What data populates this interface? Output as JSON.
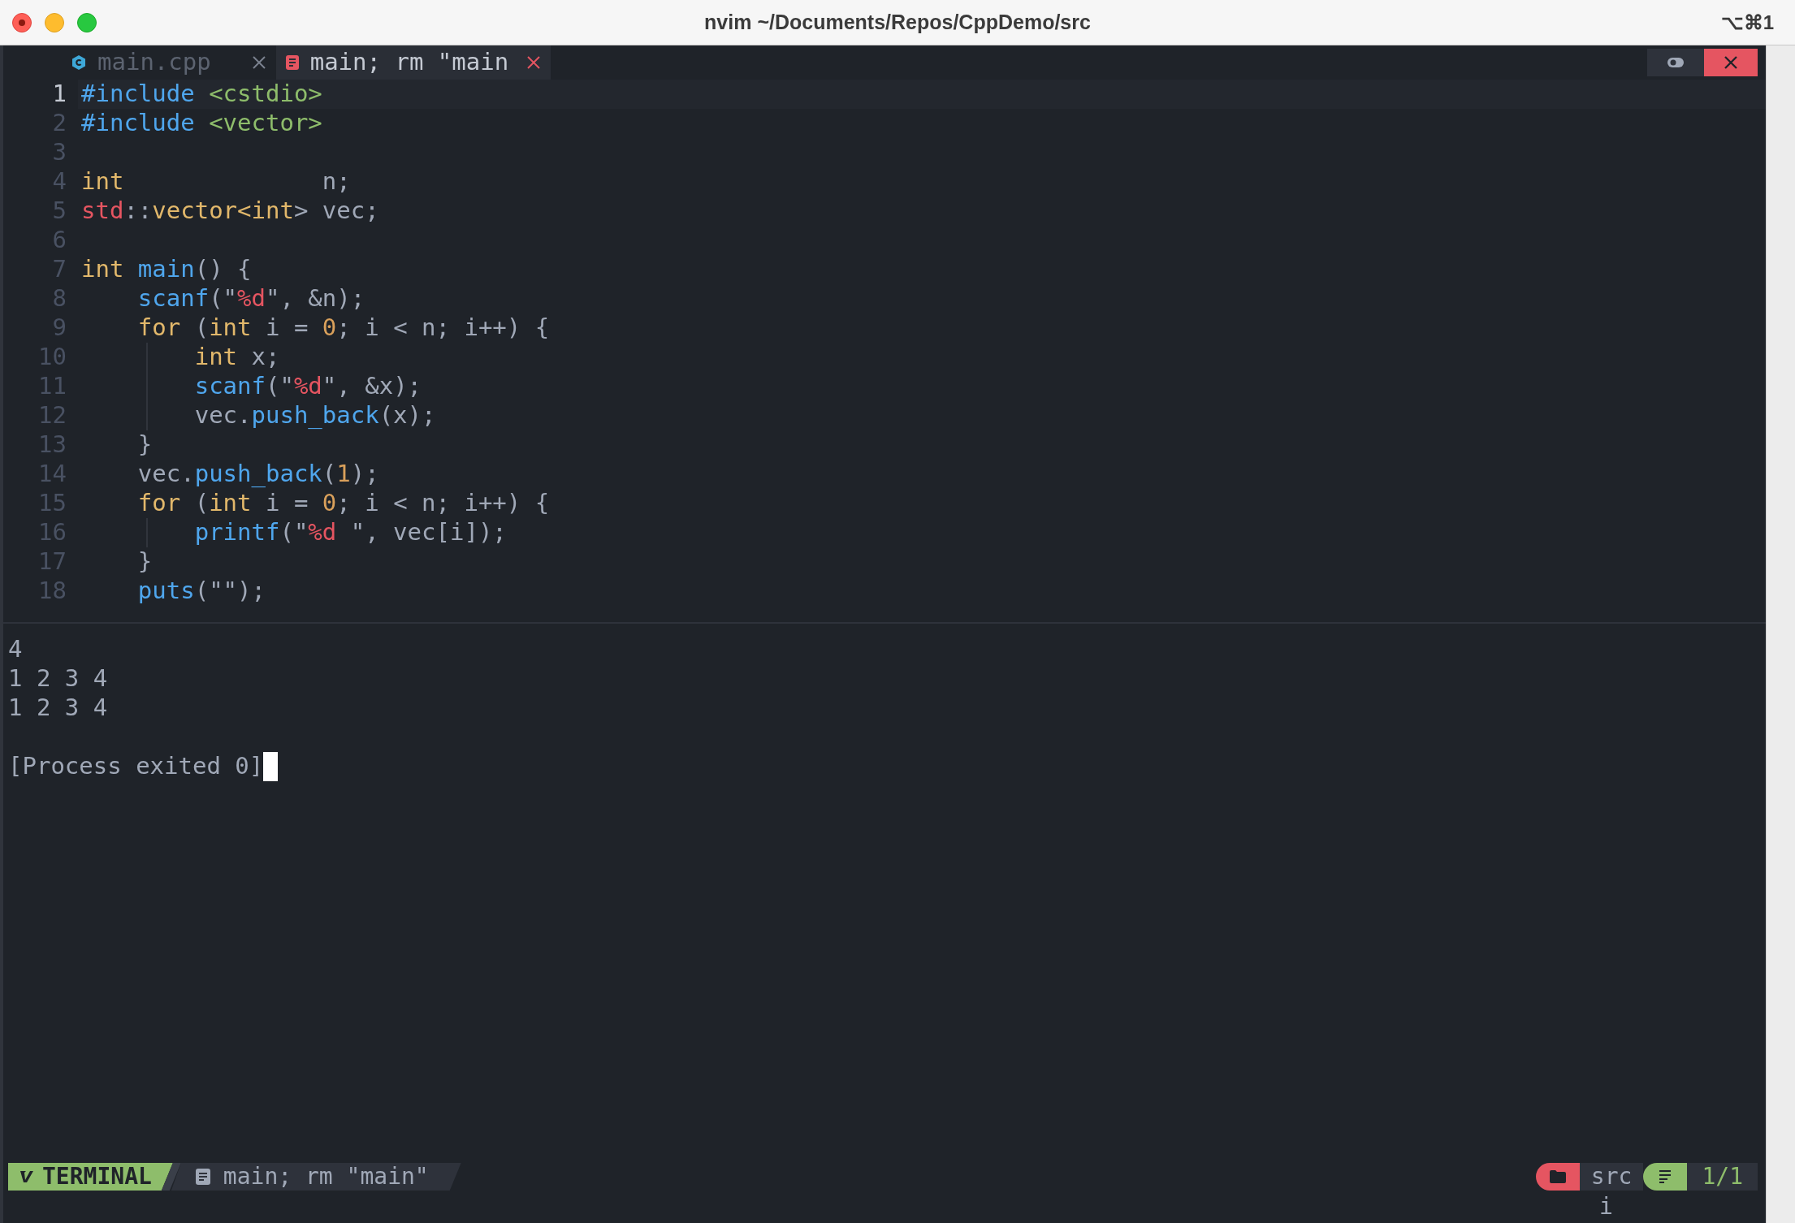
{
  "window": {
    "title": "nvim ~/Documents/Repos/CppDemo/src",
    "shortcut": "⌥⌘1"
  },
  "tabs": [
    {
      "label": "main.cpp",
      "selected": false,
      "kind": "source"
    },
    {
      "label": "main; rm \"main",
      "selected": true,
      "kind": "terminal"
    }
  ],
  "code_lines": [
    {
      "number": "1",
      "current": true,
      "guide": false,
      "tokens": [
        {
          "t": "#include ",
          "kind": "preproc"
        },
        {
          "t": "<cstdio>",
          "kind": "path"
        }
      ]
    },
    {
      "number": "2",
      "current": false,
      "guide": false,
      "tokens": [
        {
          "t": "#include ",
          "kind": "preproc"
        },
        {
          "t": "<vector>",
          "kind": "path"
        }
      ]
    },
    {
      "number": "3",
      "current": false,
      "guide": false
    },
    {
      "number": "4",
      "current": false,
      "guide": false,
      "tokens": [
        {
          "t": "int",
          "kind": "type"
        },
        {
          "t": "              n;",
          "kind": "plain"
        }
      ]
    },
    {
      "number": "5",
      "current": false,
      "guide": false,
      "tokens": [
        {
          "t": "std",
          "kind": "namespace"
        },
        {
          "t": "::",
          "kind": "plain"
        },
        {
          "t": "vector<int",
          "kind": "type"
        },
        {
          "t": "> vec;",
          "kind": "plain"
        }
      ]
    },
    {
      "number": "6",
      "current": false,
      "guide": false
    },
    {
      "number": "7",
      "current": false,
      "guide": false,
      "tokens": [
        {
          "t": "int ",
          "kind": "type"
        },
        {
          "t": "main",
          "kind": "func"
        },
        {
          "t": "() {",
          "kind": "plain"
        }
      ]
    },
    {
      "number": "8",
      "current": false,
      "guide": false,
      "tokens": [
        {
          "t": "    scanf",
          "kind": "func"
        },
        {
          "t": "(\"",
          "kind": "plain"
        },
        {
          "t": "%d",
          "kind": "format"
        },
        {
          "t": "\", &n);",
          "kind": "plain"
        }
      ]
    },
    {
      "number": "9",
      "current": false,
      "guide": false,
      "tokens": [
        {
          "t": "    for",
          "kind": "type"
        },
        {
          "t": " (",
          "kind": "plain"
        },
        {
          "t": "int",
          "kind": "type"
        },
        {
          "t": " i = ",
          "kind": "plain"
        },
        {
          "t": "0",
          "kind": "number"
        },
        {
          "t": "; i < n; i++) {",
          "kind": "plain"
        }
      ]
    },
    {
      "number": "10",
      "current": false,
      "guide": true,
      "tokens": [
        {
          "t": "        int",
          "kind": "type"
        },
        {
          "t": " x;",
          "kind": "plain"
        }
      ]
    },
    {
      "number": "11",
      "current": false,
      "guide": true,
      "tokens": [
        {
          "t": "        scanf",
          "kind": "func"
        },
        {
          "t": "(\"",
          "kind": "plain"
        },
        {
          "t": "%d",
          "kind": "format"
        },
        {
          "t": "\", &x);",
          "kind": "plain"
        }
      ]
    },
    {
      "number": "12",
      "current": false,
      "guide": true,
      "tokens": [
        {
          "t": "        vec.",
          "kind": "plain"
        },
        {
          "t": "push_back",
          "kind": "func"
        },
        {
          "t": "(x);",
          "kind": "plain"
        }
      ]
    },
    {
      "number": "13",
      "current": false,
      "guide": false,
      "tokens": [
        {
          "t": "    }",
          "kind": "plain"
        }
      ]
    },
    {
      "number": "14",
      "current": false,
      "guide": false,
      "tokens": [
        {
          "t": "    vec.",
          "kind": "plain"
        },
        {
          "t": "push_back",
          "kind": "func"
        },
        {
          "t": "(",
          "kind": "plain"
        },
        {
          "t": "1",
          "kind": "number"
        },
        {
          "t": ");",
          "kind": "plain"
        }
      ]
    },
    {
      "number": "15",
      "current": false,
      "guide": false,
      "tokens": [
        {
          "t": "    for",
          "kind": "type"
        },
        {
          "t": " (",
          "kind": "plain"
        },
        {
          "t": "int",
          "kind": "type"
        },
        {
          "t": " i = ",
          "kind": "plain"
        },
        {
          "t": "0",
          "kind": "number"
        },
        {
          "t": "; i < n; i++) {",
          "kind": "plain"
        }
      ]
    },
    {
      "number": "16",
      "current": false,
      "guide": true,
      "tokens": [
        {
          "t": "        printf",
          "kind": "func"
        },
        {
          "t": "(\"",
          "kind": "plain"
        },
        {
          "t": "%d",
          "kind": "format"
        },
        {
          "t": " \", vec[i]);",
          "kind": "plain"
        }
      ]
    },
    {
      "number": "17",
      "current": false,
      "guide": false,
      "tokens": [
        {
          "t": "    }",
          "kind": "plain"
        }
      ]
    },
    {
      "number": "18",
      "current": false,
      "guide": false,
      "tokens": [
        {
          "t": "    puts",
          "kind": "func"
        },
        {
          "t": "(\"\");",
          "kind": "plain"
        }
      ]
    }
  ],
  "terminal": {
    "output": [
      "4",
      "1 2 3 4",
      "1 2 3 4"
    ],
    "exit_message": "[Process exited 0]",
    "cursor": true
  },
  "status_bar": {
    "mode": "TERMINAL",
    "file": "main; rm \"main\"",
    "directory": "src",
    "position": "1/1"
  },
  "command_line": "i"
}
